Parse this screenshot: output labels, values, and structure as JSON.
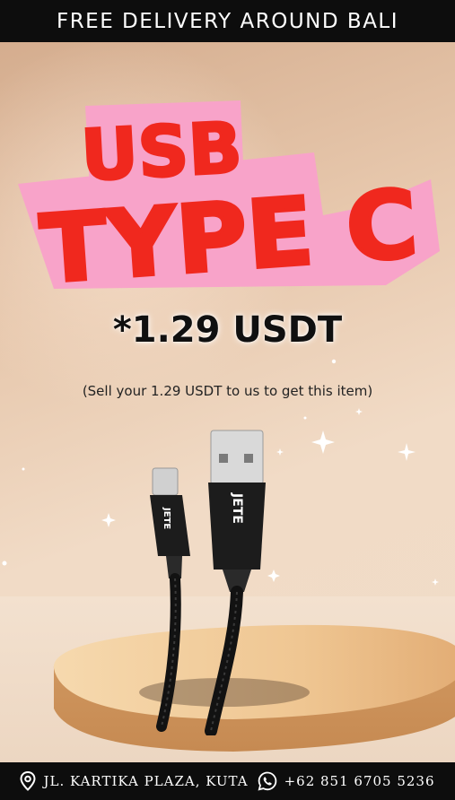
{
  "header": {
    "text": "FREE DELIVERY AROUND BALI"
  },
  "title": {
    "line1": "USB",
    "line2": "TYPE C"
  },
  "price": {
    "text": "*1.29 USDT"
  },
  "note": {
    "text": "(Sell your 1.29 USDT to us to get this item)"
  },
  "product": {
    "brand": "JETE",
    "brand_head": "JETE",
    "icon": "usb-type-c-cable"
  },
  "footer": {
    "address": "JL. KARTIKA PLAZA, KUTA",
    "address_icon": "location-pin-icon",
    "phone": "+62 851 6705 5236",
    "phone_icon": "whatsapp-icon"
  },
  "colors": {
    "title_red": "#f0281e",
    "title_pink": "#f8a3c9",
    "bar_black": "#0d0d0d"
  }
}
